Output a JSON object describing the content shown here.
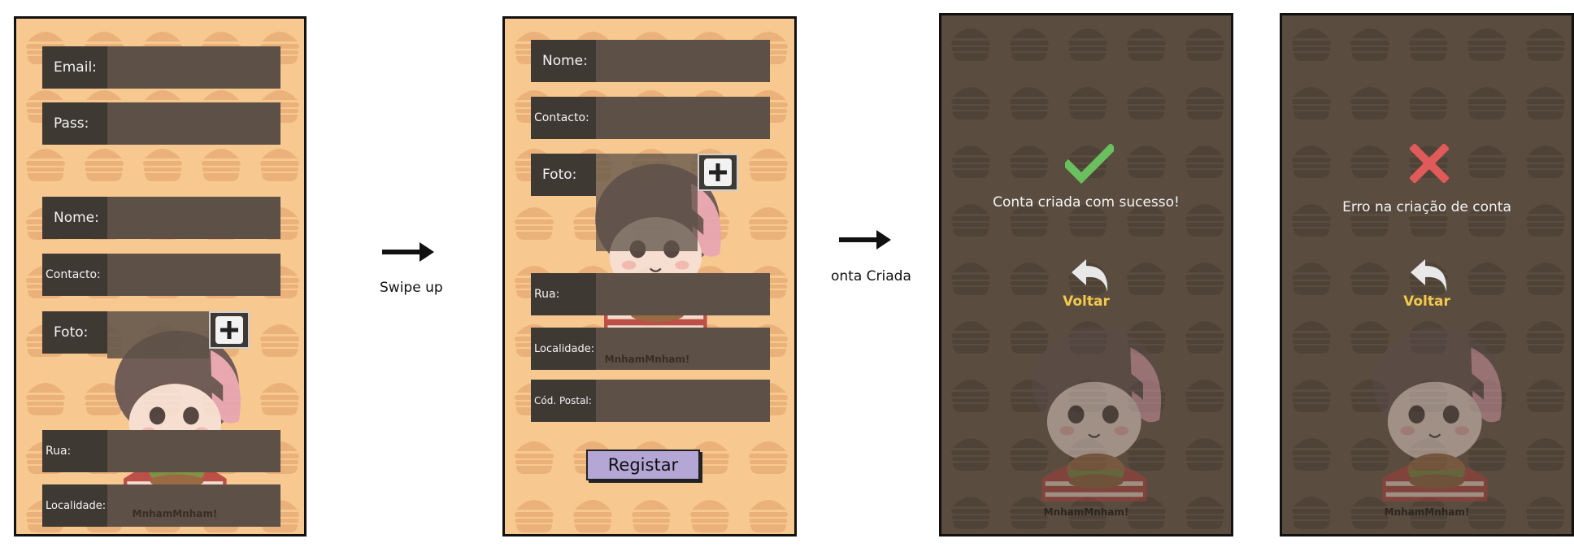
{
  "screen_login": {
    "fields": [
      {
        "label": "Email:"
      },
      {
        "label": "Pass:"
      },
      {
        "label": "Nome:"
      },
      {
        "label": "Contacto:"
      },
      {
        "label": "Foto:"
      },
      {
        "label": "Rua:"
      },
      {
        "label": "Localidade:"
      }
    ],
    "mascot_caption": "MnhamMnham!"
  },
  "transition_1": {
    "label": "Swipe up"
  },
  "screen_register": {
    "fields": [
      {
        "label": "Nome:"
      },
      {
        "label": "Contacto:"
      },
      {
        "label": "Foto:"
      },
      {
        "label": "Rua:"
      },
      {
        "label": "Localidade:"
      },
      {
        "label": "Cód. Postal:"
      }
    ],
    "mascot_caption": "MnhamMnham!",
    "register_button": "Registar"
  },
  "transition_2": {
    "label": "onta Criada"
  },
  "screen_success": {
    "message": "Conta criada com sucesso!",
    "back_label": "Voltar",
    "mascot_caption": "MnhamMnham!",
    "icon": "check-icon",
    "icon_color": "#6abf5f"
  },
  "screen_error": {
    "message": "Erro na criação de conta",
    "back_label": "Voltar",
    "mascot_caption": "MnhamMnham!",
    "icon": "cross-icon",
    "icon_color": "#e05a5a"
  },
  "colors": {
    "light_background": "#f8c891",
    "dark_background": "#5a4c3f",
    "field_label_bg": "#3f3934",
    "accent_voltar": "#f2c94c",
    "register_button": "#b4a7d6"
  }
}
